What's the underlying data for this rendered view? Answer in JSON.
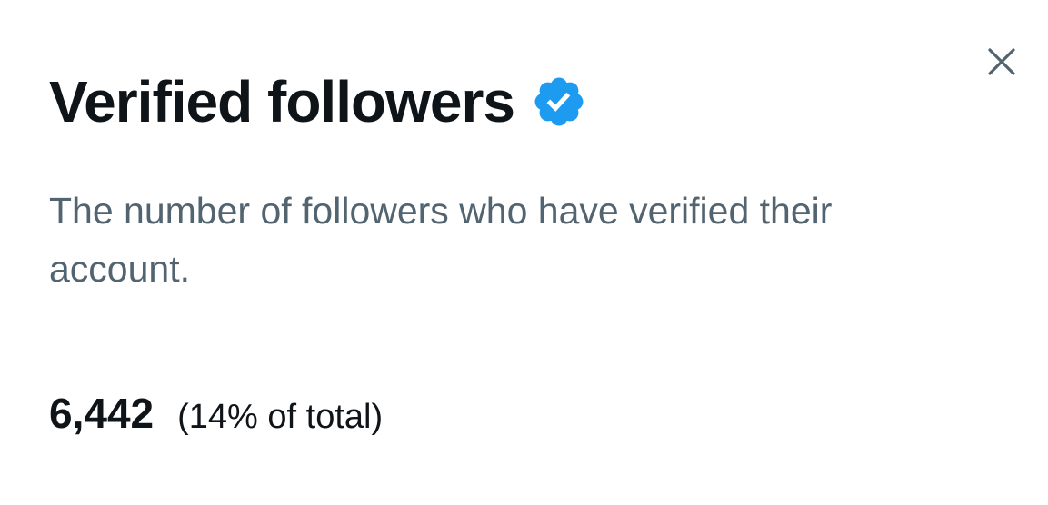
{
  "dialog": {
    "title": "Verified followers",
    "badge_icon": "verified-badge-icon",
    "badge_color": "#1d9bf0",
    "close_icon": "close-icon",
    "description": "The number of followers who have verified their account.",
    "stat": {
      "value": "6,442",
      "share": "(14% of total)"
    }
  },
  "colors": {
    "title": "#0f1419",
    "description": "#536471",
    "close_icon": "#536471",
    "background": "#ffffff"
  }
}
